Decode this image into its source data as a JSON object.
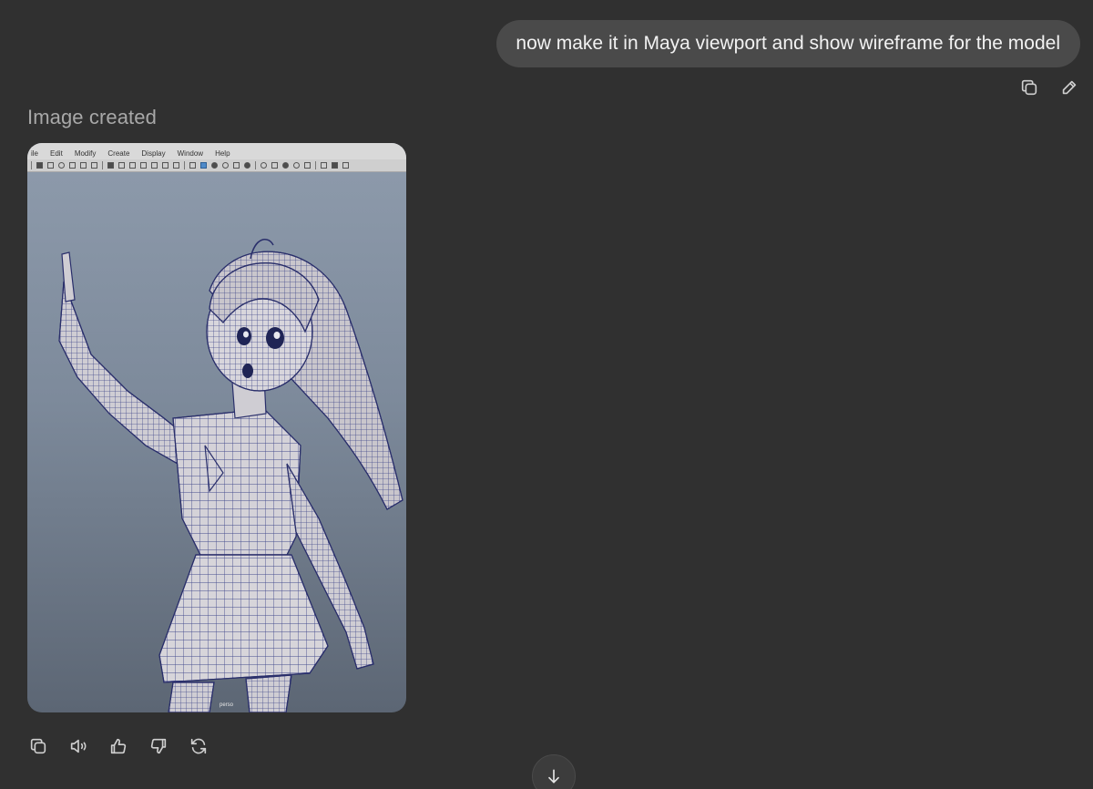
{
  "conversation": {
    "user_message": "now make it in Maya viewport and show wireframe for the model",
    "status_label": "Image created"
  },
  "user_actions": [
    {
      "name": "copy-icon"
    },
    {
      "name": "edit-pencil-icon"
    }
  ],
  "generated_image": {
    "menu": [
      "ile",
      "Edit",
      "Modify",
      "Create",
      "Display",
      "Window",
      "Help"
    ],
    "viewport_label": "perso"
  },
  "assistant_actions": [
    {
      "name": "copy-icon"
    },
    {
      "name": "read-aloud-icon"
    },
    {
      "name": "thumbs-up-icon"
    },
    {
      "name": "thumbs-down-icon"
    },
    {
      "name": "regenerate-icon"
    }
  ],
  "scroll": {
    "icon": "arrow-down-icon"
  }
}
